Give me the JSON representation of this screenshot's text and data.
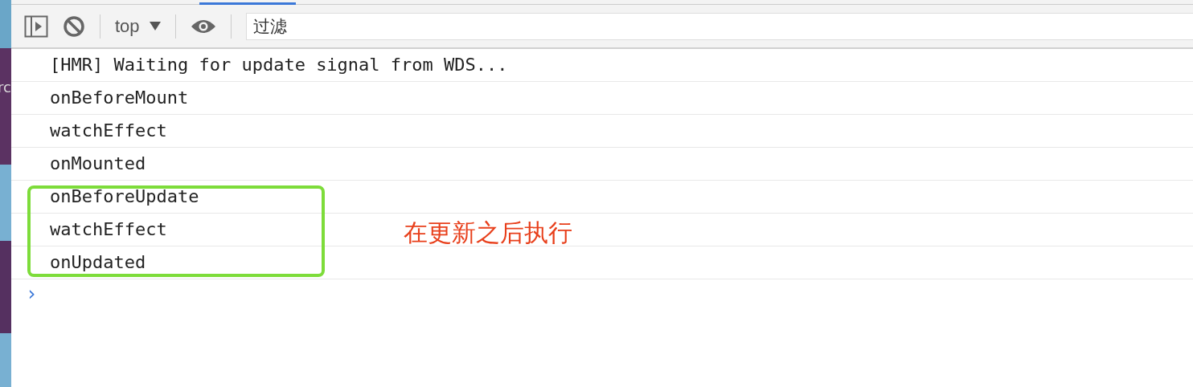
{
  "background_page": {
    "text": "rc"
  },
  "toolbar": {
    "context": "top",
    "filter": {
      "placeholder": "过滤"
    }
  },
  "console": {
    "messages": [
      {
        "text": "[HMR] Waiting for update signal from WDS..."
      },
      {
        "text": "onBeforeMount"
      },
      {
        "text": "watchEffect"
      },
      {
        "text": "onMounted"
      }
    ],
    "framed_messages": [
      {
        "text": "onBeforeUpdate"
      },
      {
        "text": "watchEffect"
      },
      {
        "text": "onUpdated"
      }
    ],
    "prompt": "›"
  },
  "annotation": {
    "text": "在更新之后执行"
  }
}
